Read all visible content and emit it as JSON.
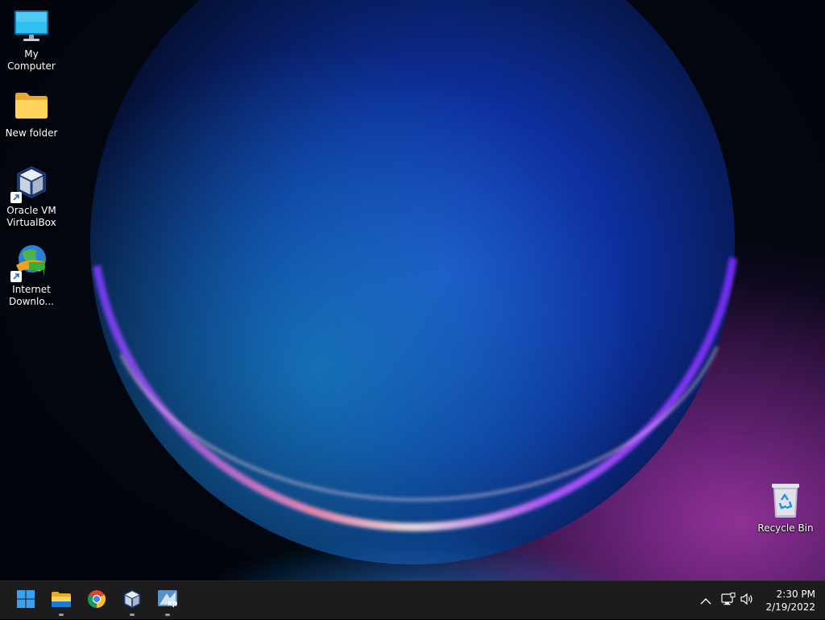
{
  "desktop": {
    "icons": [
      {
        "label": "My Computer",
        "icon": "monitor-icon"
      },
      {
        "label": "New folder",
        "icon": "folder-icon"
      },
      {
        "label": "Oracle VM\nVirtualBox",
        "icon": "virtualbox-icon",
        "shortcut": true
      },
      {
        "label": "Internet\nDownlo...",
        "icon": "idm-globe-icon",
        "shortcut": true
      },
      {
        "label": "Recycle Bin",
        "icon": "recycle-bin-icon"
      }
    ]
  },
  "taskbar": {
    "pinned": [
      {
        "name": "start-button",
        "icon": "windows-logo-icon",
        "running": false
      },
      {
        "name": "file-explorer",
        "icon": "folder-icon",
        "running": true
      },
      {
        "name": "chrome",
        "icon": "chrome-icon",
        "running": false
      },
      {
        "name": "virtualbox",
        "icon": "virtualbox-icon",
        "running": true
      },
      {
        "name": "windows-xp-vm",
        "icon": "xp-vm-icon",
        "running": true
      }
    ],
    "tray": {
      "icons": [
        "chevron-up-icon",
        "network-icon",
        "volume-icon"
      ]
    },
    "clock": {
      "time": "2:30 PM",
      "date": "2/19/2022"
    }
  },
  "colors": {
    "taskbar_bg": "#1c1c1e",
    "accent_blue": "#1e90ff",
    "wallpaper_purple": "#8a2be2"
  }
}
